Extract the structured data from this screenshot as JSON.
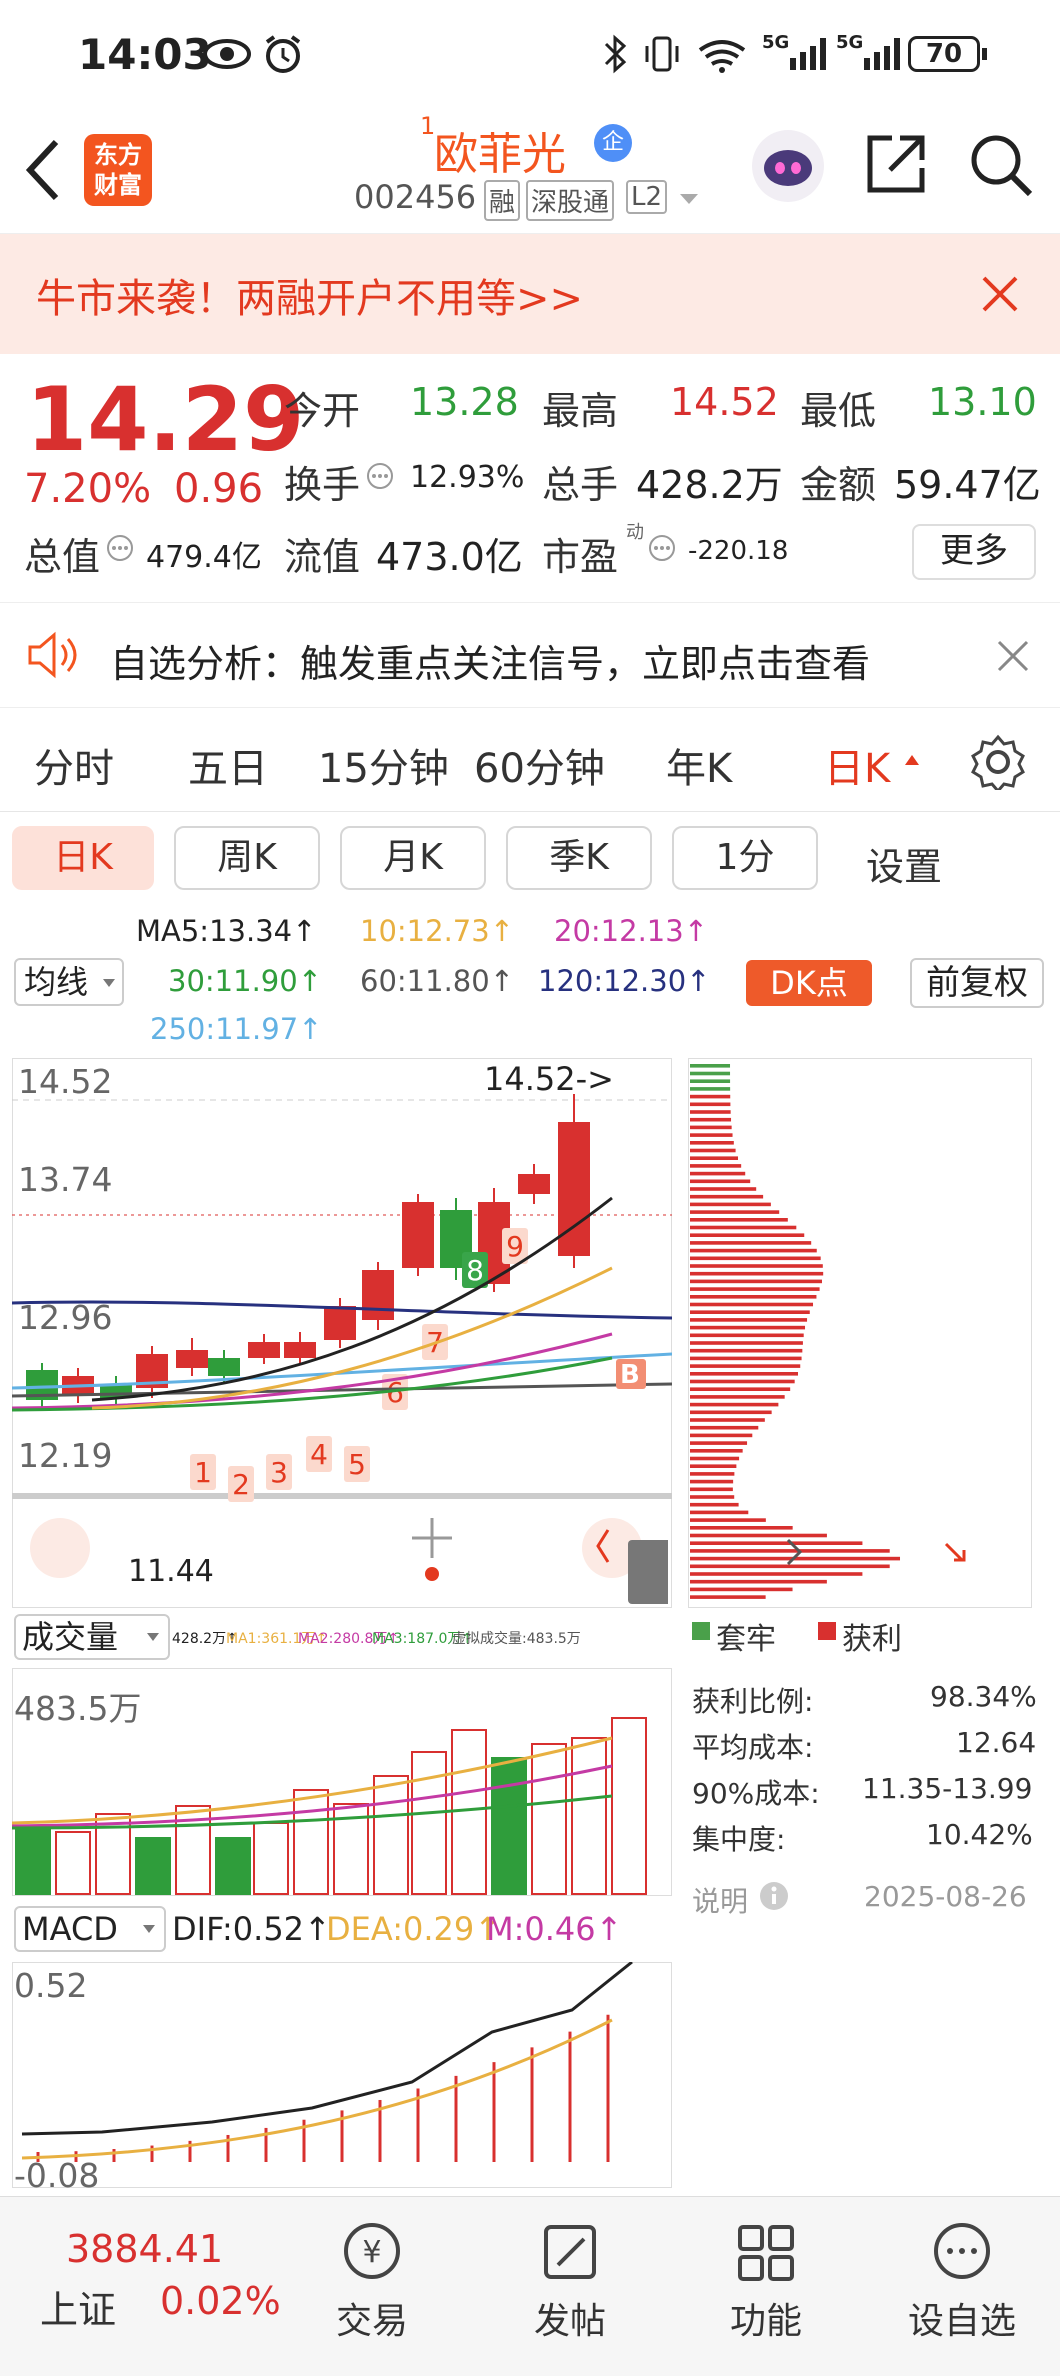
{
  "status": {
    "time": "14:03",
    "net1": "5G",
    "net2": "5G",
    "battery": "70"
  },
  "nav": {
    "logo_line1": "东方",
    "logo_line2": "财富",
    "title_sup": "1",
    "title": "欧菲光",
    "badge": "企",
    "code": "002456",
    "tag1": "融",
    "tag2": "深股通",
    "tag3": "L2"
  },
  "banner": {
    "text": "牛市来袭！两融开户不用等>>"
  },
  "quote": {
    "price": "14.29",
    "pct": "7.20%",
    "chg": "0.96",
    "open_label": "今开",
    "open": "13.28",
    "high_label": "最高",
    "high": "14.52",
    "low_label": "最低",
    "low": "13.10",
    "turn_label": "换手",
    "turn": "12.93%",
    "vol_label": "总手",
    "vol": "428.2万",
    "amt_label": "金额",
    "amt": "59.47亿",
    "mcap_label": "总值",
    "mcap": "479.4亿",
    "float_label": "流值",
    "float": "473.0亿",
    "pe_label": "市盈",
    "pe_sup": "动",
    "pe": "-220.18",
    "more": "更多"
  },
  "alert": {
    "text": "自选分析：触发重点关注信号，立即点击查看"
  },
  "tabs": [
    "分时",
    "五日",
    "15分钟",
    "60分钟",
    "年K",
    "日K"
  ],
  "ktabs": [
    "日K",
    "周K",
    "月K",
    "季K",
    "1分",
    "设置"
  ],
  "ma": {
    "ma5": "MA5:13.34↑",
    "ma10": "10:12.73↑",
    "ma20": "20:12.13↑",
    "ma30": "30:11.90↑",
    "ma60": "60:11.80↑",
    "ma120": "120:12.30↑",
    "ma250": "250:11.97↑",
    "selector": "均线",
    "dk": "DK点",
    "fq": "前复权"
  },
  "chart": {
    "y_labels": [
      "14.52",
      "13.74",
      "12.96",
      "12.19"
    ],
    "high_marker": "14.52->",
    "low_marker": "11.44",
    "signals": [
      "1",
      "2",
      "3",
      "4",
      "5",
      "6",
      "7",
      "8",
      "9"
    ],
    "b_marker": "B"
  },
  "volume": {
    "selector": "成交量",
    "info": "428.2万↑",
    "ma1": "MA1:361.1万↑",
    "ma2": "MA2:280.8万↑",
    "ma3": "MA3:187.0万↑",
    "virtual": "虚拟成交量:483.5万",
    "max": "483.5万"
  },
  "macd": {
    "selector": "MACD",
    "dif": "DIF:0.52↑",
    "dea": "DEA:0.29↑",
    "m": "M:0.46↑",
    "top": "0.52",
    "bottom": "-0.08"
  },
  "chips": {
    "legend1": "套牢",
    "legend2": "获利",
    "rows": [
      {
        "k": "获利比例:",
        "v": "98.34%"
      },
      {
        "k": "平均成本:",
        "v": "12.64"
      },
      {
        "k": "90%成本:",
        "v": "11.35-13.99"
      },
      {
        "k": "集中度:",
        "v": "10.42%"
      }
    ],
    "note": "说明",
    "date": "2025-08-26"
  },
  "bottom": {
    "index_val": "3884.41",
    "index_name": "上证",
    "index_pct": "0.02%",
    "b1": "交易",
    "b2": "发帖",
    "b3": "功能",
    "b4": "设自选"
  },
  "colors": {
    "up": "#d8302f",
    "down": "#2f9d3b",
    "accent": "#e3391f",
    "brand": "#f3551f"
  }
}
